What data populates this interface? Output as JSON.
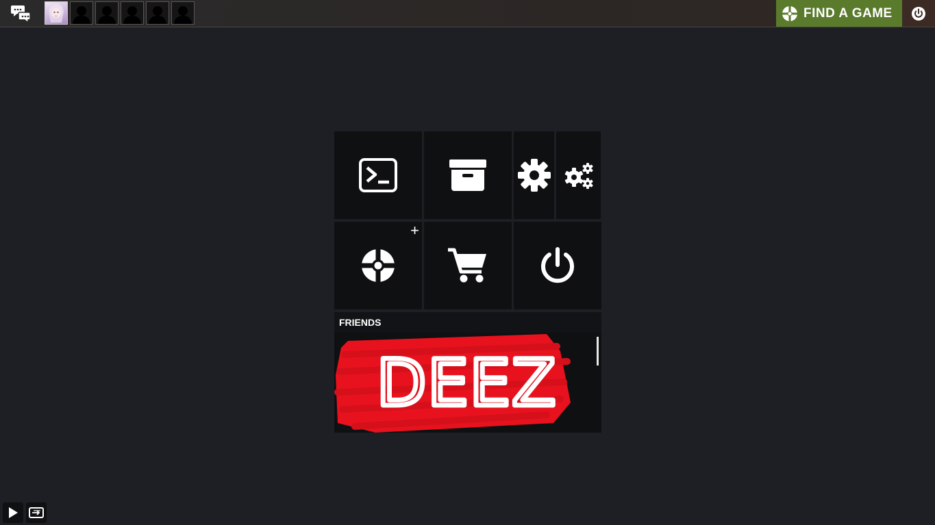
{
  "topbar": {
    "chat_icon": "chat-bubbles-icon",
    "avatars": [
      {
        "kind": "user"
      },
      {
        "kind": "silhouette"
      },
      {
        "kind": "silhouette"
      },
      {
        "kind": "silhouette"
      },
      {
        "kind": "silhouette"
      },
      {
        "kind": "silhouette"
      }
    ],
    "find_game_label": "FIND A GAME",
    "find_game_color": "#5a7a2c",
    "quit_icon": "power-icon"
  },
  "menu_tiles": [
    {
      "name": "console",
      "icon": "terminal-icon"
    },
    {
      "name": "backpack",
      "icon": "archive-box-icon"
    },
    {
      "name": "options",
      "icon": "gear-icon"
    },
    {
      "name": "advanced-options",
      "icon": "gears-icon"
    },
    {
      "name": "create-server",
      "icon": "tf2-logo-icon",
      "badge": "+"
    },
    {
      "name": "store",
      "icon": "cart-icon"
    },
    {
      "name": "quit",
      "icon": "power-icon"
    }
  ],
  "friends": {
    "title": "FRIENDS",
    "scribble_text": "DEEZ",
    "scribble_color": "#e8121e"
  },
  "bottom_buttons": [
    {
      "name": "play",
      "icon": "play-icon"
    },
    {
      "name": "replay",
      "icon": "replay-icon"
    }
  ]
}
